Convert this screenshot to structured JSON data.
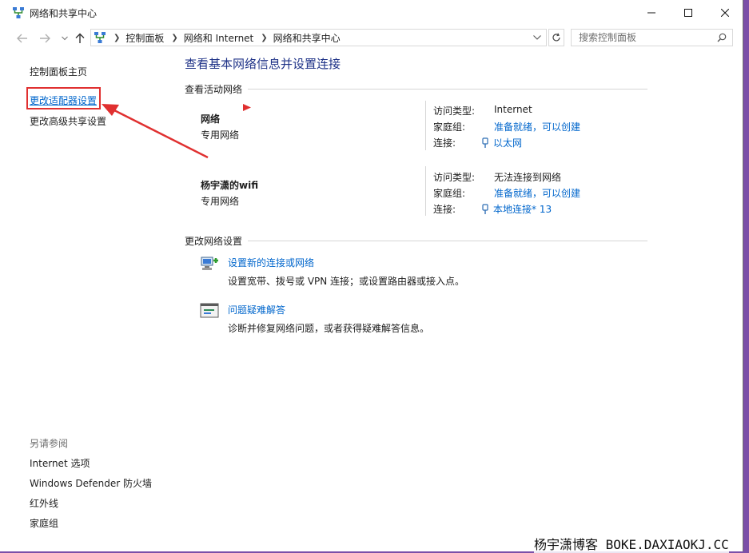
{
  "window": {
    "title": "网络和共享中心",
    "minimize_label": "minimize",
    "maximize_label": "maximize",
    "close_label": "close"
  },
  "address": {
    "crumbs": [
      "控制面板",
      "网络和 Internet",
      "网络和共享中心"
    ],
    "search_placeholder": "搜索控制面板"
  },
  "sidebar": {
    "home": "控制面板主页",
    "items": [
      "更改适配器设置",
      "更改高级共享设置"
    ],
    "see_also_title": "另请参阅",
    "see_also": [
      "Internet 选项",
      "Windows Defender 防火墙",
      "红外线",
      "家庭组"
    ]
  },
  "main": {
    "title": "查看基本网络信息并设置连接",
    "active_networks_heading": "查看活动网络",
    "networks": [
      {
        "name": "网络",
        "type": "专用网络",
        "access_label": "访问类型:",
        "access_value": "Internet",
        "homegroup_label": "家庭组:",
        "homegroup_value": "准备就绪，可以创建",
        "connection_label": "连接:",
        "connection_value": "以太网"
      },
      {
        "name": "杨宇潇的wifi",
        "type": "专用网络",
        "access_label": "访问类型:",
        "access_value": "无法连接到网络",
        "homegroup_label": "家庭组:",
        "homegroup_value": "准备就绪，可以创建",
        "connection_label": "连接:",
        "connection_value": "本地连接* 13"
      }
    ],
    "change_settings_heading": "更改网络设置",
    "tasks": [
      {
        "link": "设置新的连接或网络",
        "desc": "设置宽带、拨号或 VPN 连接；或设置路由器或接入点。",
        "icon": "new-connection-icon"
      },
      {
        "link": "问题疑难解答",
        "desc": "诊断并修复网络问题，或者获得疑难解答信息。",
        "icon": "troubleshoot-icon"
      }
    ]
  },
  "watermark": "杨宇潇博客 BOKE.DAXIAOKJ.CC",
  "colors": {
    "link": "#0066cc",
    "title": "#1e3287",
    "highlight_box": "#e03030",
    "desktop": "#7b4fa8"
  }
}
